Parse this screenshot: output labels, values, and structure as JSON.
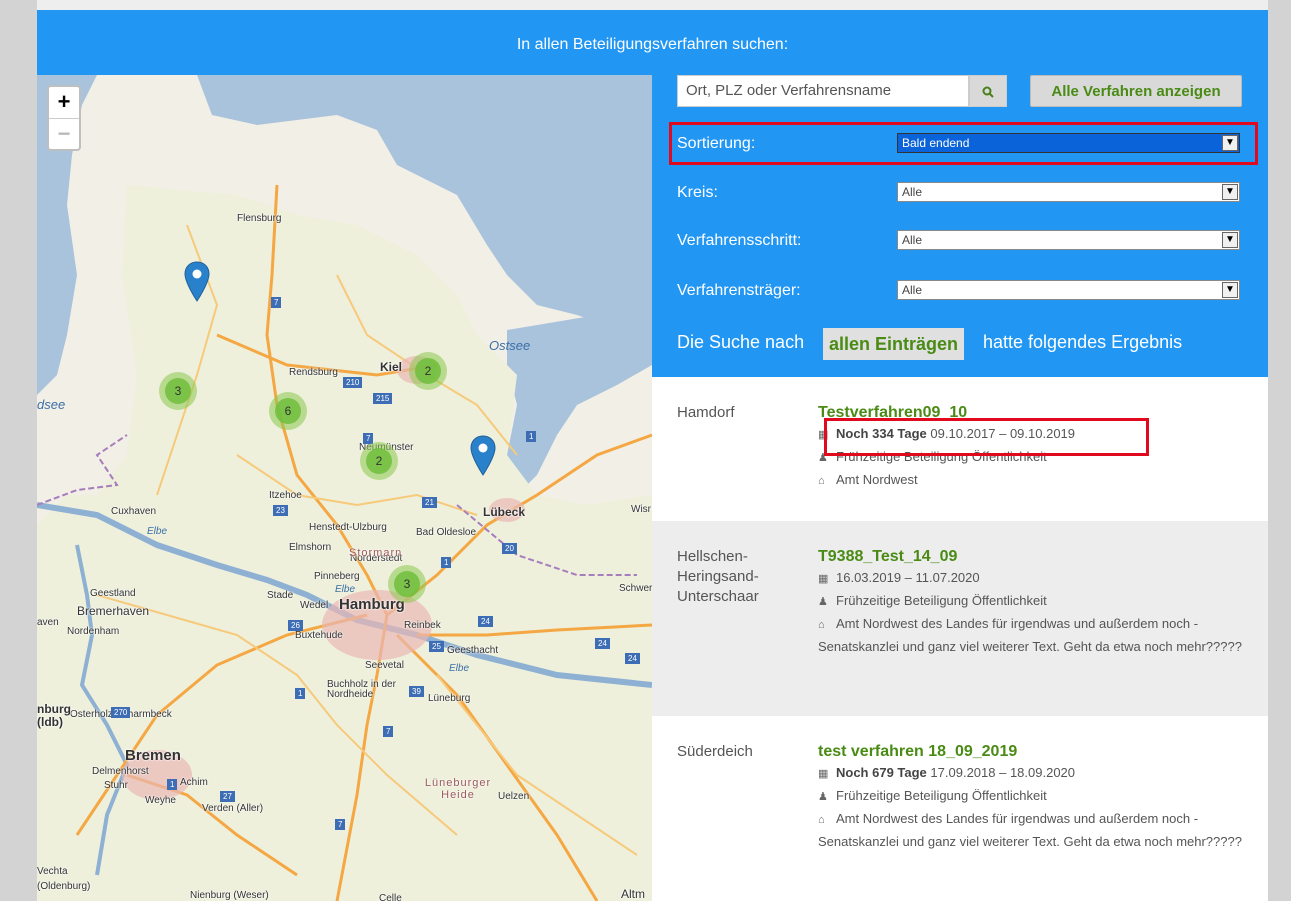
{
  "banner": {
    "title": "In allen Beteiligungsverfahren suchen:"
  },
  "map": {
    "zoom_in": "+",
    "zoom_out": "−",
    "seas": [
      "Ostsee",
      "dsee",
      "Elbe",
      "Elbe",
      "Elbe"
    ],
    "cities": [
      "Flensburg",
      "Rendsburg",
      "Kiel",
      "Neumünster",
      "Itzehoe",
      "Lübeck",
      "Cuxhaven",
      "Elmshorn",
      "Henstedt-Ulzburg",
      "Bad Oldesloe",
      "Norderstedt",
      "Pinneberg",
      "Geestland",
      "Stade",
      "Wedel",
      "Hamburg",
      "Bremerhaven",
      "Nordenham",
      "Buxtehude",
      "Reinbek",
      "Geesthacht",
      "Seevetal",
      "Buchholz in der Nordheide",
      "Lüneburg",
      "Osterholz-Scharmbeck",
      "Bremen",
      "Delmenhorst",
      "Stuhr",
      "Achim",
      "Weyhe",
      "Verden (Aller)",
      "Uelzen",
      "Vechta",
      "(Oldenburg)",
      "Nienburg (Weser)",
      "Celle",
      "Altm",
      "Wisr",
      "Schwer",
      "aven",
      "nburg (ldb)",
      "Stormarn",
      "Lüneburger Heide"
    ],
    "clusters": [
      "3",
      "6",
      "2",
      "2",
      "3"
    ]
  },
  "search": {
    "placeholder": "Ort, PLZ oder Verfahrensname",
    "search_icon": "search-icon",
    "all_button": "Alle Verfahren anzeigen"
  },
  "filters": [
    {
      "label": "Sortierung:",
      "value": "Bald endend"
    },
    {
      "label": "Kreis:",
      "value": "Alle"
    },
    {
      "label": "Verfahrensschritt:",
      "value": "Alle"
    },
    {
      "label": "Verfahrensträger:",
      "value": "Alle"
    }
  ],
  "summary": {
    "prefix": "Die Suche nach",
    "tag": "allen Einträgen",
    "suffix": "hatte folgendes Ergebnis"
  },
  "results": [
    {
      "place": "Hamdorf",
      "title": "Testverfahren09_10",
      "days": "Noch 334 Tage",
      "dates": "09.10.2017 – 09.10.2019",
      "step": "Frühzeitige Beteiligung Öffentlichkeit",
      "authority": "Amt Nordwest"
    },
    {
      "place": "Hellschen-Heringsand-Unterschaar",
      "title": "T9388_Test_14_09",
      "days": "",
      "dates": "16.03.2019 – 11.07.2020",
      "step": "Frühzeitige Beteiligung Öffentlichkeit",
      "authority": "Amt Nordwest des Landes für irgendwas und außerdem noch - Senatskanzlei und ganz viel weiterer Text. Geht da etwa noch mehr?????"
    },
    {
      "place": "Süderdeich",
      "title": "test verfahren 18_09_2019",
      "days": "Noch 679 Tage",
      "dates": "17.09.2018 – 18.09.2020",
      "step": "Frühzeitige Beteiligung Öffentlichkeit",
      "authority": "Amt Nordwest des Landes für irgendwas und außerdem noch - Senatskanzlei und ganz viel weiterer Text. Geht da etwa noch mehr?????"
    }
  ],
  "colors": {
    "accent_blue": "#2196f3",
    "title_green": "#4a8b15",
    "highlight_red": "#e0091d"
  }
}
